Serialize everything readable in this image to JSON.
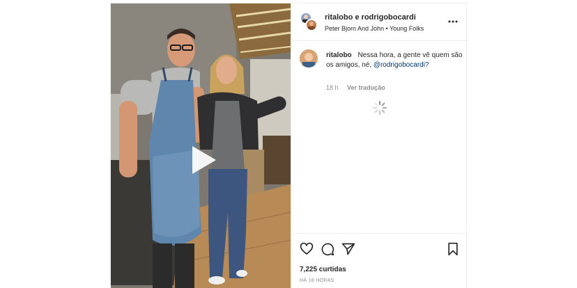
{
  "header": {
    "title": "ritalobo e rodrigobocardi",
    "audio": "Peter Bjorn And John • Young Folks",
    "more_icon": "more-horizontal-icon"
  },
  "caption": {
    "username": "ritalobo",
    "text": "Nessa hora, a gente vê quem são os amigos, né,",
    "mention": "@rodrigobocardi?",
    "time": "18 h",
    "translate_label": "Ver tradução"
  },
  "actions": {
    "icons": [
      "heart-icon",
      "comment-icon",
      "share-icon",
      "bookmark-icon"
    ],
    "likes": "7,225 curtidas",
    "timestamp": "HÁ 18 HORAS"
  },
  "colors": {
    "text": "#262626",
    "muted": "#8e8e8e",
    "link": "#00376b",
    "border": "#efefef"
  }
}
